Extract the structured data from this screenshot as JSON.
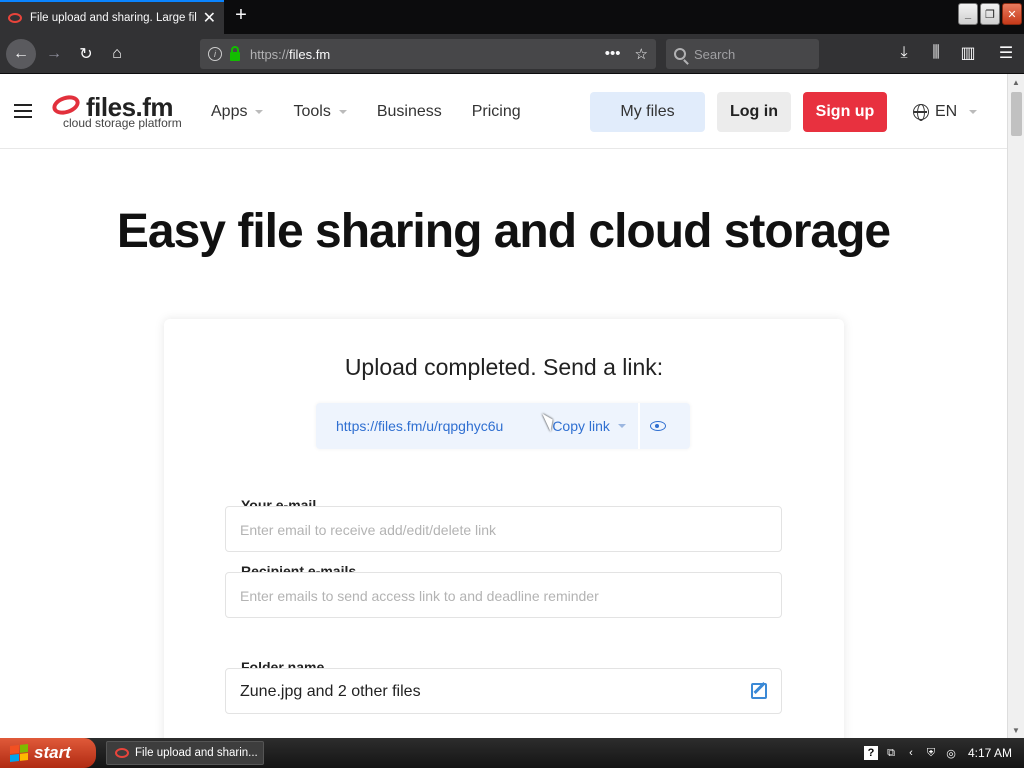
{
  "browser": {
    "tab_title": "File upload and sharing. Large file",
    "url_proto": "https://",
    "url_host": "files.fm",
    "search_placeholder": "Search"
  },
  "site": {
    "logo_name": "files.fm",
    "logo_tagline": "cloud storage platform",
    "nav": {
      "apps": "Apps",
      "tools": "Tools",
      "business": "Business",
      "pricing": "Pricing"
    },
    "my_files": "My files",
    "log_in": "Log in",
    "sign_up": "Sign up",
    "language": "EN"
  },
  "hero": {
    "title": "Easy file sharing and cloud storage"
  },
  "upload": {
    "title": "Upload completed. Send a link:",
    "link": "https://files.fm/u/rqpghyc6u",
    "copy_link": "Copy link",
    "your_email_label": "Your e-mail",
    "your_email_placeholder": "Enter email to receive add/edit/delete link",
    "recipient_label": "Recipient e-mails",
    "recipient_placeholder": "Enter emails to send access link to and deadline reminder",
    "folder_label": "Folder name",
    "folder_value": "Zune.jpg and 2 other files"
  },
  "taskbar": {
    "start": "start",
    "task": "File upload and sharin...",
    "clock": "4:17 AM"
  },
  "colors": {
    "accent_red": "#e8313f",
    "link_blue": "#2f6fd1",
    "my_files_bg": "#e1ecfb"
  }
}
